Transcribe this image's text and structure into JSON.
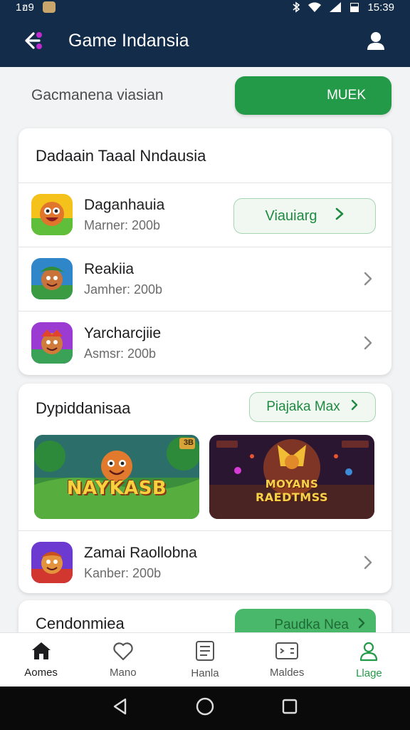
{
  "status": {
    "left_text": "1ฮ9",
    "time": "15:39"
  },
  "app": {
    "title": "Game Indansia"
  },
  "top": {
    "subtitle": "Gacmanena viasian",
    "button": "MUEK"
  },
  "section1": {
    "title": "Dadaain Taaal Nndausia",
    "items": [
      {
        "name": "Daganhauia",
        "meta": "Marner: 200b",
        "action": "Viauiarg"
      },
      {
        "name": "Reakiia",
        "meta": "Jamher: 200b"
      },
      {
        "name": "Yarcharcjiie",
        "meta": "Asmsr: 200b"
      }
    ]
  },
  "section2": {
    "title": "Dypiddanisaa",
    "action": "Piajaka Max",
    "banners": [
      {
        "text": "NAYKASB",
        "badge": "3B"
      },
      {
        "text_line1": "MOYANS",
        "text_line2": "RAEDTMSS"
      }
    ],
    "item": {
      "name": "Zamai Raollobna",
      "meta": "Kanber: 200b"
    }
  },
  "section3": {
    "title": "Cendonmiea",
    "action": "Paudka Nea"
  },
  "nav": [
    {
      "label": "Aomes",
      "icon": "home-icon"
    },
    {
      "label": "Mano",
      "icon": "heart-icon"
    },
    {
      "label": "Hanla",
      "icon": "list-icon"
    },
    {
      "label": "Maldes",
      "icon": "card-icon"
    },
    {
      "label": "Llage",
      "icon": "person-icon"
    }
  ],
  "colors": {
    "header": "#132c49",
    "accent": "#239a48"
  }
}
